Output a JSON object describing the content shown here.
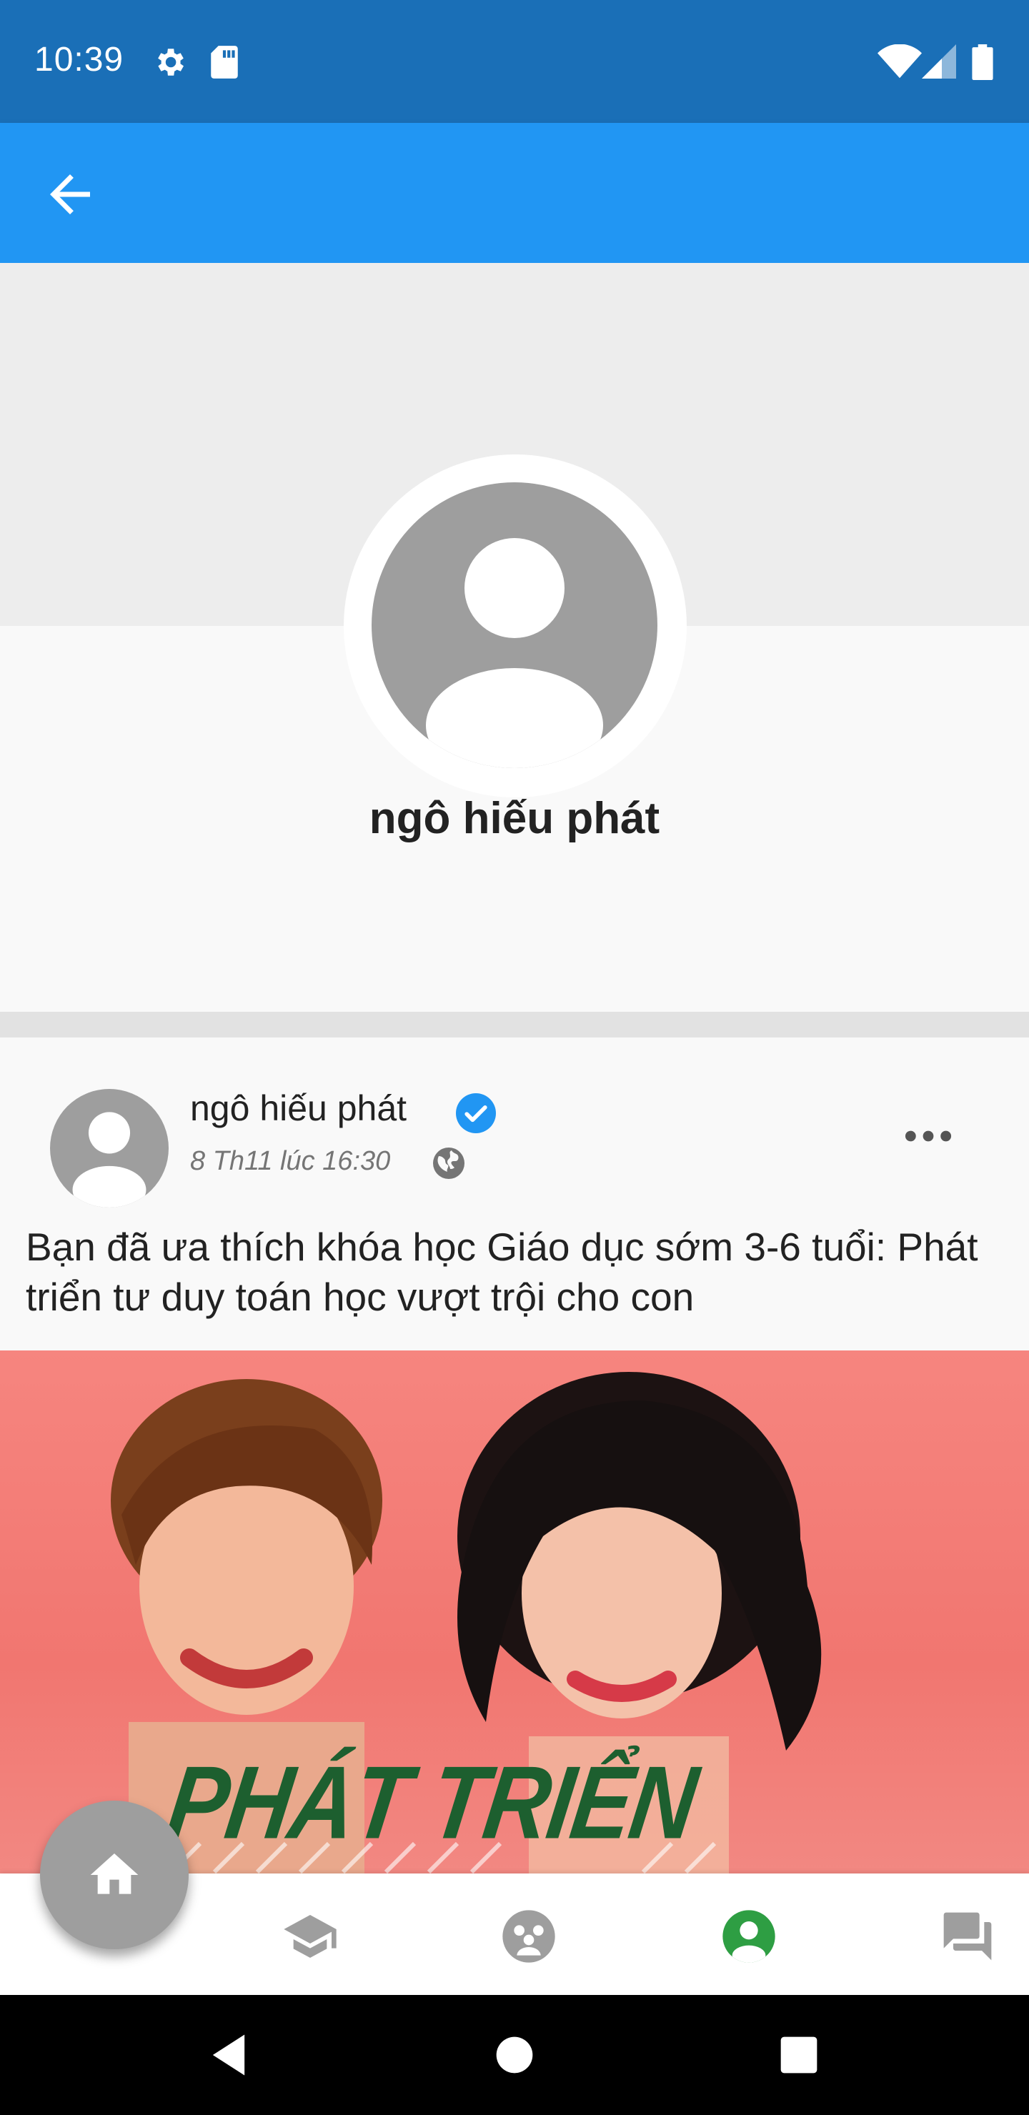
{
  "status_bar": {
    "time": "10:39",
    "icons": [
      "settings-icon",
      "sd-card-icon",
      "wifi-icon",
      "signal-icon",
      "battery-icon"
    ]
  },
  "toolbar": {
    "back_icon": "arrow-back-icon"
  },
  "profile": {
    "name": "ngô hiếu phát"
  },
  "post": {
    "author": "ngô hiếu phát",
    "timestamp": "8 Th11 lúc 16:30",
    "text": "Bạn đã ưa thích khóa học Giáo dục sớm 3-6 tuổi: Phát triển tư duy toán học vượt trội cho con",
    "image_text": "PHÁT TRIỂN"
  },
  "bottom_nav": {
    "items": [
      "home-icon",
      "school-icon",
      "groups-icon",
      "account-icon",
      "chat-icon"
    ],
    "active": "account-icon"
  },
  "colors": {
    "status_bar": "#1a6fb7",
    "toolbar": "#2196f3",
    "active_nav": "#2e9e43",
    "inactive_nav": "#9e9e9e",
    "verified": "#2196f3"
  }
}
